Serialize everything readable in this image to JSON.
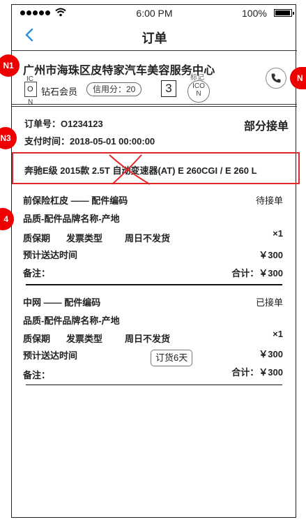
{
  "status_bar": {
    "time": "6:00 PM",
    "battery": "100%"
  },
  "navbar": {
    "back_icon": "chevron-left-icon",
    "title": "订单"
  },
  "shop": {
    "name": "广州市海珠区皮特家汽车美容服务中心",
    "icon_placeholder": {
      "top": "IC",
      "mid": "O",
      "bottom": "N"
    },
    "member_level": "钻石会员",
    "credit_score": "信用分：20",
    "count": "3",
    "mark_icon": {
      "label": "标记",
      "top": "ICO",
      "bottom": "N"
    },
    "phone_icon": "phone-icon"
  },
  "order": {
    "number": "订单号：O1234123",
    "status": "部分接单",
    "pay_time": "支付时间：2018-05-01 00:00:00"
  },
  "car": {
    "model": "奔驰E级 2015款 2.5T 自动变速器(AT) E 260CGI / E 260 L"
  },
  "items": [
    {
      "title": "前保险杠皮 —— 配件编码",
      "status": "待接单",
      "quality": "品质-配件品牌名称-产地",
      "attrs": [
        "质保期",
        "发票类型",
        "周日不发货"
      ],
      "qty": "×1",
      "delivery_label": "预计送达时间",
      "price": "￥300",
      "note_label": "备注：",
      "total": "合计：￥300"
    },
    {
      "title": "中网 —— 配件编码",
      "status": "已接单",
      "quality": "品质-配件品牌名称-产地",
      "attrs": [
        "质保期",
        "发票类型",
        "周日不发货"
      ],
      "qty": "×1",
      "delivery_label": "预计送达时间",
      "price": "￥300",
      "note_label": "备注：",
      "total": "合计：￥300",
      "tag": "订货6天"
    }
  ],
  "annotations": {
    "n1": "N1",
    "n2": "N",
    "n3": "N3",
    "n4": "4"
  },
  "colors": {
    "accent": "#2b8fe8",
    "alert": "#e02626",
    "badge": "#e00000"
  }
}
